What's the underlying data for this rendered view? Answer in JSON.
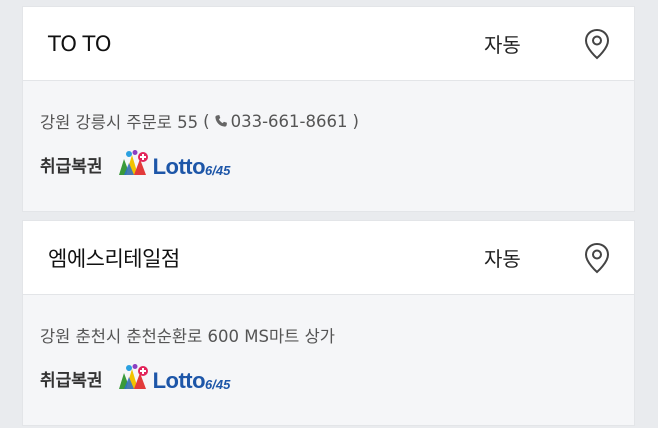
{
  "stores": [
    {
      "name": "TO TO",
      "type": "자동",
      "address": "강원 강릉시 주문로 55",
      "phone": "033-661-8661",
      "paren_open": "(",
      "paren_close": ")",
      "handling_label": "취급복권",
      "lottery_brand": "Lotto",
      "lottery_variant": "6/45"
    },
    {
      "name": "엠에스리테일점",
      "type": "자동",
      "address": "강원 춘천시 춘천순환로 600 MS마트 상가",
      "handling_label": "취급복권",
      "lottery_brand": "Lotto",
      "lottery_variant": "6/45"
    }
  ],
  "icons": {
    "map": "map-pin-icon",
    "phone": "phone-icon",
    "lotto": "lotto-logo-icon"
  },
  "colors": {
    "brand_blue": "#1d56a8",
    "background": "#e9ebee",
    "card_body": "#f5f6f8"
  }
}
